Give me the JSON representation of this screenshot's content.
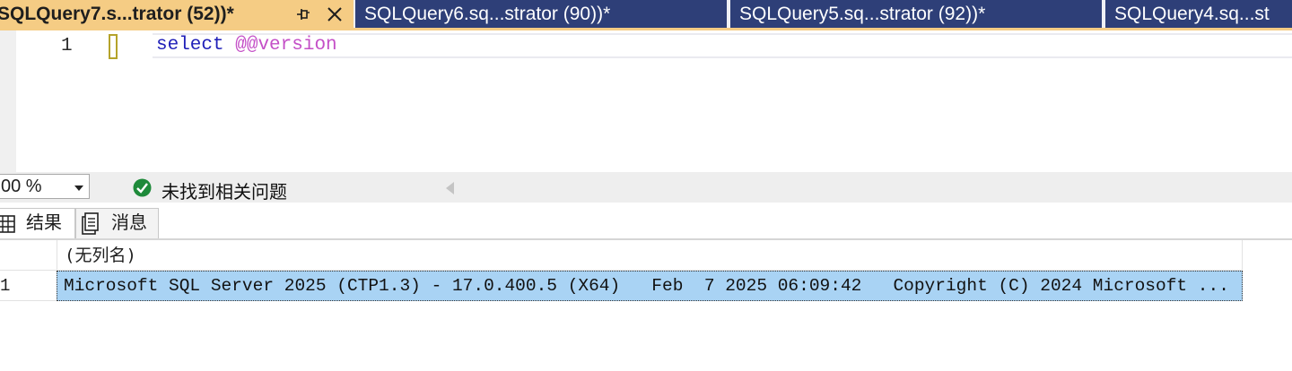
{
  "tabs": [
    {
      "title": "SQLQuery7.s...trator (52))*",
      "active": true
    },
    {
      "title": "SQLQuery6.sq...strator (90))*",
      "active": false
    },
    {
      "title": "SQLQuery5.sq...strator (92))*",
      "active": false
    },
    {
      "title": "SQLQuery4.sq...st",
      "active": false
    }
  ],
  "editor": {
    "line_number": "1",
    "code_keyword": "select",
    "code_variable": "@@version"
  },
  "statusbar": {
    "zoom": "00 %",
    "issues_text": "未找到相关问题"
  },
  "result_tabs": {
    "results_label": "结果",
    "messages_label": "消息"
  },
  "grid": {
    "column_header": "(无列名)",
    "rows": [
      {
        "num": "1",
        "value": "Microsoft SQL Server 2025 (CTP1.3) - 17.0.400.5 (X64)   Feb  7 2025 06:09:42   Copyright (C) 2024 Microsoft ..."
      }
    ]
  },
  "icons": [
    "pin-icon",
    "close-icon",
    "check-circle-icon",
    "grid-icon",
    "message-icon"
  ],
  "colors": {
    "active_tab": "#f5cc84",
    "inactive_tab": "#2e3f78",
    "keyword": "#1f1fb8",
    "variable": "#c44fc7",
    "selection": "#a9d3f4",
    "ok_green": "#1e8a3a"
  }
}
